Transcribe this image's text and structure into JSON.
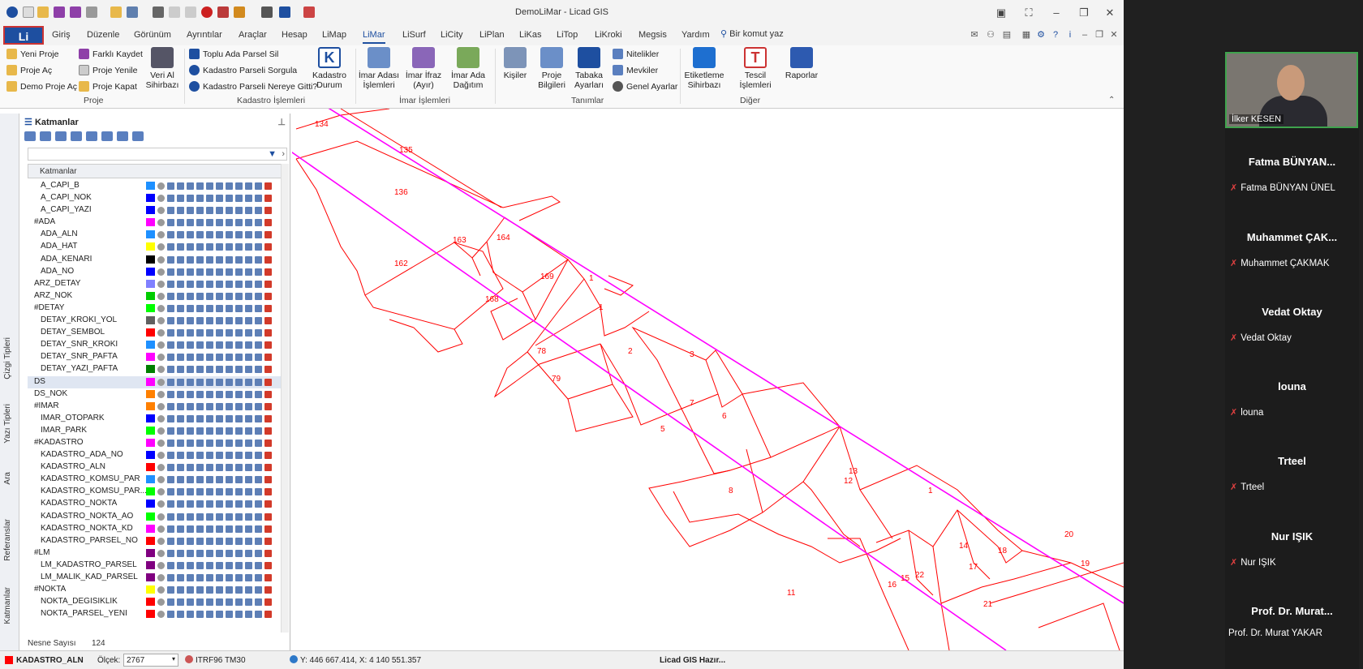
{
  "window_title": "DemoLiMar - Licad GIS",
  "file_button": "Li",
  "menu_tabs": [
    "Giriş",
    "Düzenle",
    "Görünüm",
    "Ayrıntılar",
    "Araçlar",
    "Hesap",
    "LiMap",
    "LiMar",
    "LiSurf",
    "LiCity",
    "LiPlan",
    "LiKas",
    "LiTop",
    "LiKroki",
    "Megsis",
    "Yardım"
  ],
  "active_tab": "LiMar",
  "command_search": "Bir komut yaz",
  "ribbon": {
    "proje": {
      "yeni": "Yeni Proje",
      "ac": "Proje Aç",
      "demo": "Demo Proje Aç",
      "farkli": "Farklı Kaydet",
      "yenile": "Proje Yenile",
      "kapat": "Proje Kapat",
      "veri_al": "Veri Al Sihirbazı",
      "group": "Proje"
    },
    "kadastro": {
      "toplu": "Toplu Ada Parsel Sil",
      "sorgula": "Kadastro Parseli Sorgula",
      "nereye": "Kadastro Parseli Nereye Gitti?",
      "durum": "Kadastro Durum",
      "group": "Kadastro İşlemleri"
    },
    "imar": {
      "adasi": "İmar Adası İşlemleri",
      "ifraz": "İmar İfraz (Ayır)",
      "dagitim": "İmar Ada Dağıtım",
      "group": "İmar İşlemleri"
    },
    "tanimlar": {
      "kisiler": "Kişiler",
      "proje_bilgileri": "Proje Bilgileri",
      "tabaka": "Tabaka Ayarları",
      "nitelikler": "Nitelikler",
      "mevkiler": "Mevkiler",
      "genel": "Genel Ayarlar",
      "group": "Tanımlar"
    },
    "diger": {
      "etiket": "Etiketleme Sihirbazı",
      "tescil": "Tescil İşlemleri",
      "raporlar": "Raporlar",
      "group": "Diğer"
    }
  },
  "panel": {
    "title": "Katmanlar",
    "column_header": "Katmanlar",
    "side_tabs": [
      "Çizgi Tipleri",
      "Yazı Tipleri",
      "Ara",
      "Referanslar",
      "Katmanlar"
    ],
    "layers": [
      {
        "name": "A_CAPI_B",
        "color": "#1e90ff",
        "indent": 1
      },
      {
        "name": "A_CAPI_NOK",
        "color": "#0000ff",
        "indent": 1
      },
      {
        "name": "A_CAPI_YAZI",
        "color": "#0000ff",
        "indent": 1
      },
      {
        "name": "#ADA",
        "color": "#ff00ff",
        "indent": 0
      },
      {
        "name": "ADA_ALN",
        "color": "#1e90ff",
        "indent": 1
      },
      {
        "name": "ADA_HAT",
        "color": "#ffff00",
        "indent": 1
      },
      {
        "name": "ADA_KENARI",
        "color": "#000000",
        "indent": 1
      },
      {
        "name": "ADA_NO",
        "color": "#0000ff",
        "indent": 1
      },
      {
        "name": "ARZ_DETAY",
        "color": "#8080ff",
        "indent": 0
      },
      {
        "name": "ARZ_NOK",
        "color": "#00cc00",
        "indent": 0
      },
      {
        "name": "#DETAY",
        "color": "#00ff00",
        "indent": 0
      },
      {
        "name": "DETAY_KROKI_YOL",
        "color": "#606060",
        "indent": 1
      },
      {
        "name": "DETAY_SEMBOL",
        "color": "#ff0000",
        "indent": 1
      },
      {
        "name": "DETAY_SNR_KROKI",
        "color": "#1e90ff",
        "indent": 1
      },
      {
        "name": "DETAY_SNR_PAFTA",
        "color": "#ff00ff",
        "indent": 1
      },
      {
        "name": "DETAY_YAZI_PAFTA",
        "color": "#008000",
        "indent": 1
      },
      {
        "name": "DS",
        "color": "#ff00ff",
        "indent": 0,
        "selected": true
      },
      {
        "name": "DS_NOK",
        "color": "#ff8000",
        "indent": 0
      },
      {
        "name": "#IMAR",
        "color": "#ff8000",
        "indent": 0
      },
      {
        "name": "IMAR_OTOPARK",
        "color": "#0000ff",
        "indent": 1
      },
      {
        "name": "IMAR_PARK",
        "color": "#00ff00",
        "indent": 1
      },
      {
        "name": "#KADASTRO",
        "color": "#ff00ff",
        "indent": 0
      },
      {
        "name": "KADASTRO_ADA_NO",
        "color": "#0000ff",
        "indent": 1
      },
      {
        "name": "KADASTRO_ALN",
        "color": "#ff0000",
        "indent": 1
      },
      {
        "name": "KADASTRO_KOMSU_PAR",
        "color": "#1e90ff",
        "indent": 1
      },
      {
        "name": "KADASTRO_KOMSU_PAR...",
        "color": "#00ff00",
        "indent": 1
      },
      {
        "name": "KADASTRO_NOKTA",
        "color": "#0000ff",
        "indent": 1
      },
      {
        "name": "KADASTRO_NOKTA_AO",
        "color": "#00ff00",
        "indent": 1
      },
      {
        "name": "KADASTRO_NOKTA_KD",
        "color": "#ff00ff",
        "indent": 1
      },
      {
        "name": "KADASTRO_PARSEL_NO",
        "color": "#ff0000",
        "indent": 1
      },
      {
        "name": "#LM",
        "color": "#800080",
        "indent": 0
      },
      {
        "name": "LM_KADASTRO_PARSEL",
        "color": "#800080",
        "indent": 1
      },
      {
        "name": "LM_MALIK_KAD_PARSEL",
        "color": "#800080",
        "indent": 1
      },
      {
        "name": "#NOKTA",
        "color": "#ffff00",
        "indent": 0
      },
      {
        "name": "NOKTA_DEGISIKLIK",
        "color": "#ff0000",
        "indent": 1
      },
      {
        "name": "NOKTA_PARSEL_YENI",
        "color": "#ff0000",
        "indent": 1
      }
    ],
    "object_count_label": "Nesne Sayısı",
    "object_count": "124"
  },
  "map": {
    "parcel_color": "#ff0000",
    "road_color": "#ff00ff",
    "labels": [
      "134",
      "135",
      "136",
      "163",
      "164",
      "162",
      "169",
      "168",
      "1",
      "1",
      "78",
      "79",
      "2",
      "3",
      "7",
      "6",
      "5",
      "8",
      "12",
      "13",
      "1",
      "14",
      "18",
      "17",
      "16",
      "15",
      "22",
      "21",
      "20",
      "19",
      "11"
    ]
  },
  "status": {
    "active_layer": "KADASTRO_ALN",
    "scale_label": "Ölçek:",
    "scale_value": "2767",
    "crs": "ITRF96 TM30",
    "coords": "Y: 446 667.414, X: 4 140 551.357",
    "ready": "Licad GIS Hazır..."
  },
  "meeting": {
    "speaker": "İlker KESEN",
    "participants": [
      {
        "title": "Fatma BÜNYAN...",
        "name": "Fatma BÜNYAN ÜNEL"
      },
      {
        "title": "Muhammet ÇAK...",
        "name": "Muhammet ÇAKMAK"
      },
      {
        "title": "Vedat Oktay",
        "name": "Vedat Oktay"
      },
      {
        "title": "louna",
        "name": "louna"
      },
      {
        "title": "Trteel",
        "name": "Trteel"
      },
      {
        "title": "Nur IŞIK",
        "name": "Nur IŞIK"
      },
      {
        "title": "Prof. Dr. Murat...",
        "name": "Prof. Dr. Murat YAKAR"
      }
    ]
  }
}
